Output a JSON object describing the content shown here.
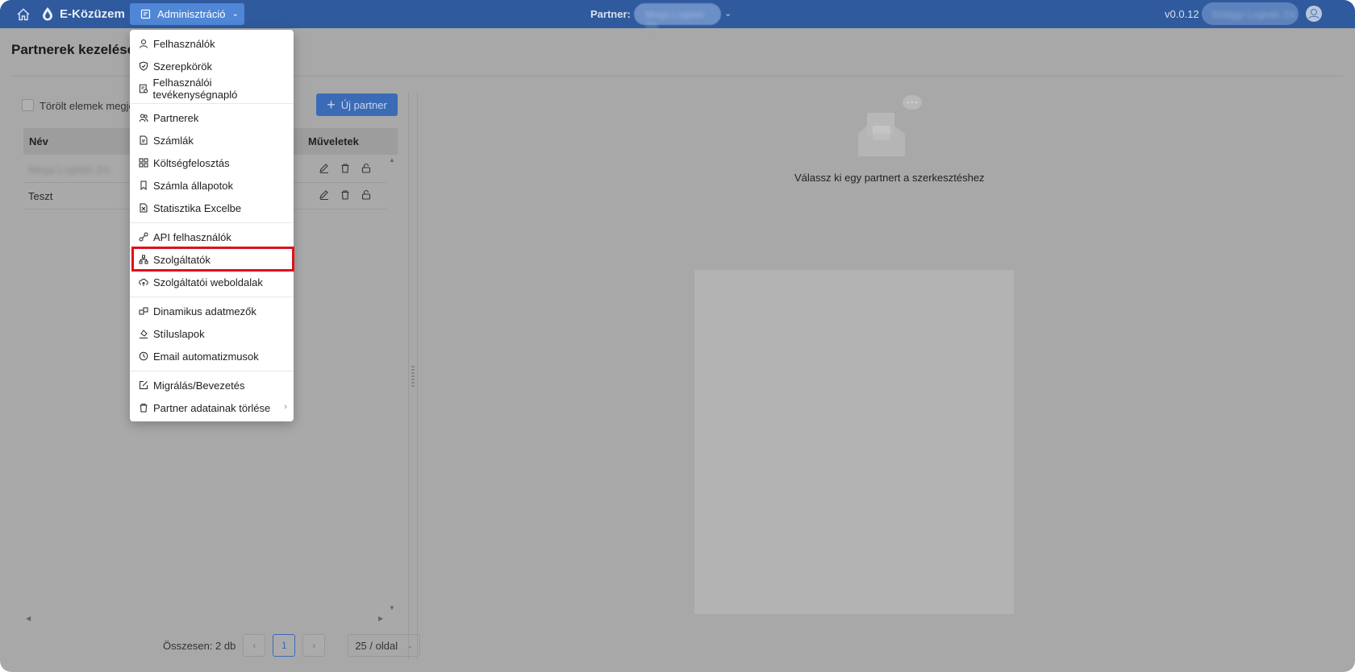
{
  "header": {
    "app_name": "E-Közüzem",
    "admin_menu_label": "Adminisztráció",
    "partner_label": "Partner:",
    "partner_value": "Mega Logistic Zrt.",
    "version": "v0.0.12",
    "user_name": "Szilágyi Logistic Zrt.",
    "accent_color": "#2f5a9e"
  },
  "page": {
    "title": "Partnerek kezelése",
    "show_deleted_label": "Törölt elemek megjel",
    "new_partner_label": "Új partner"
  },
  "table": {
    "columns": [
      "Név",
      "Műveletek"
    ],
    "rows": [
      {
        "name": "Mega Logistic Zrt."
      },
      {
        "name": "Teszt"
      }
    ],
    "total_label": "Összesen: 2 db",
    "current_page": "1",
    "page_size": "25 / oldal"
  },
  "detail": {
    "empty_text": "Válassz ki egy partnert a szerkesztéshez"
  },
  "menu": {
    "items": [
      {
        "label": "Felhasználók",
        "icon": "user-icon"
      },
      {
        "label": "Szerepkörök",
        "icon": "shield-icon"
      },
      {
        "label": "Felhasználói tevékenységnapló",
        "icon": "log-icon"
      },
      {
        "label": "Partnerek",
        "icon": "team-icon"
      },
      {
        "label": "Számlák",
        "icon": "file-icon"
      },
      {
        "label": "Költségfelosztás",
        "icon": "grid-icon"
      },
      {
        "label": "Számla állapotok",
        "icon": "bookmark-icon"
      },
      {
        "label": "Statisztika Excelbe",
        "icon": "excel-icon"
      },
      {
        "label": "API felhasználók",
        "icon": "api-icon"
      },
      {
        "label": "Szolgáltatók",
        "icon": "cluster-icon"
      },
      {
        "label": "Szolgáltatói weboldalak",
        "icon": "cloud-upload-icon"
      },
      {
        "label": "Dinamikus adatmezők",
        "icon": "fields-icon"
      },
      {
        "label": "Stíluslapok",
        "icon": "brush-icon"
      },
      {
        "label": "Email automatizmusok",
        "icon": "clock-icon"
      },
      {
        "label": "Migrálás/Bevezetés",
        "icon": "edit-square-icon"
      },
      {
        "label": "Partner adatainak törlése",
        "icon": "trash-icon"
      }
    ],
    "highlighted_item": "Szolgáltatók",
    "highlight_color": "#e0101b"
  }
}
